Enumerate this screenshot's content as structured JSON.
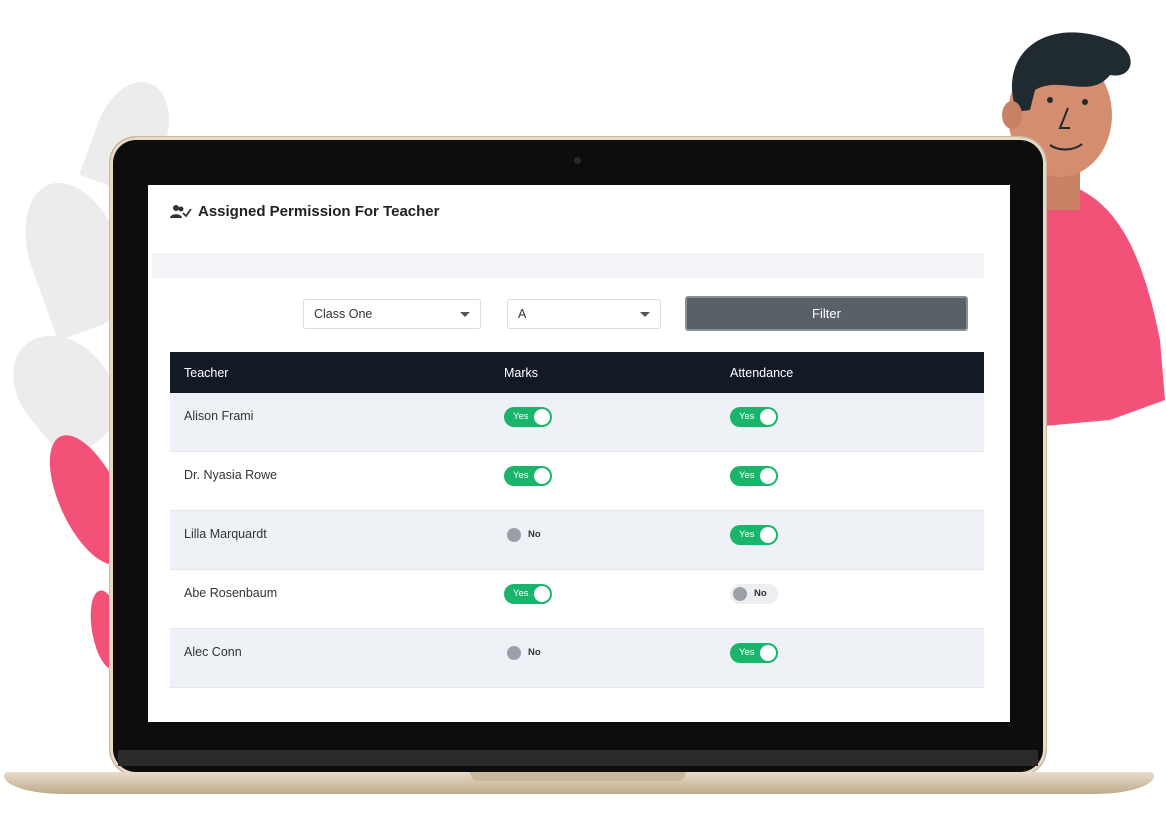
{
  "header": {
    "title": "Assigned Permission For Teacher",
    "icon": "user-check-icon"
  },
  "filters": {
    "class_value": "Class One",
    "section_value": "A",
    "filter_label": "Filter"
  },
  "table": {
    "columns": [
      "Teacher",
      "Marks",
      "Attendance"
    ],
    "rows": [
      {
        "teacher": "Alison Frami",
        "marks": true,
        "attendance": true,
        "marks_label": "Yes",
        "attendance_label": "Yes"
      },
      {
        "teacher": "Dr. Nyasia Rowe",
        "marks": true,
        "attendance": true,
        "marks_label": "Yes",
        "attendance_label": "Yes"
      },
      {
        "teacher": "Lilla Marquardt",
        "marks": false,
        "attendance": true,
        "marks_label": "No",
        "attendance_label": "Yes"
      },
      {
        "teacher": "Abe Rosenbaum",
        "marks": true,
        "attendance": false,
        "marks_label": "Yes",
        "attendance_label": "No"
      },
      {
        "teacher": "Alec Conn",
        "marks": false,
        "attendance": true,
        "marks_label": "No",
        "attendance_label": "Yes"
      }
    ]
  },
  "colors": {
    "header_bg": "#131a26",
    "toggle_on": "#19b56b",
    "button_bg": "#5a6068",
    "accent_pink": "#f25277"
  }
}
